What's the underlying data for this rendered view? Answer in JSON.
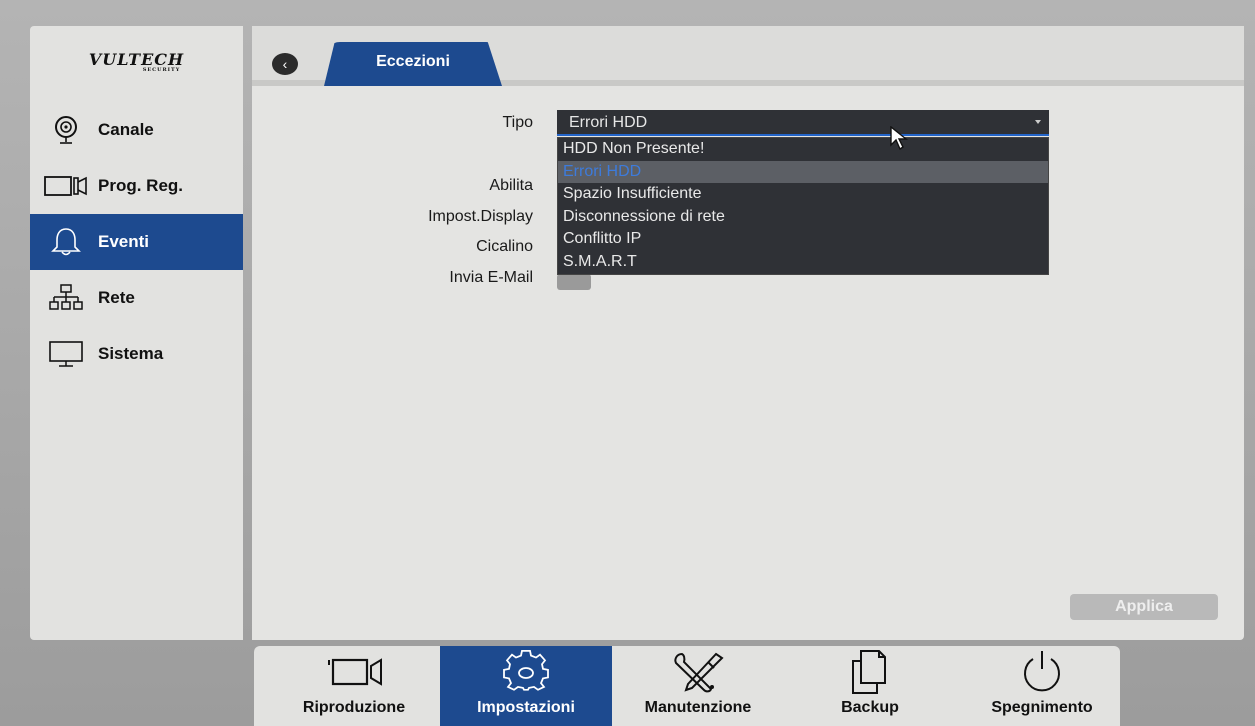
{
  "brand": {
    "name": "VULTECH",
    "tagline": "SECURITY"
  },
  "sidebar": {
    "items": [
      {
        "label": "Canale",
        "icon": "camera-icon",
        "active": false
      },
      {
        "label": "Prog. Reg.",
        "icon": "video-record-icon",
        "active": false
      },
      {
        "label": "Eventi",
        "icon": "bell-icon",
        "active": true
      },
      {
        "label": "Rete",
        "icon": "network-icon",
        "active": false
      },
      {
        "label": "Sistema",
        "icon": "monitor-icon",
        "active": false
      }
    ]
  },
  "header": {
    "tab_label": "Eccezioni",
    "back_icon": "back-arrow-icon"
  },
  "form": {
    "tipo_label": "Tipo",
    "tipo_value": "Errori HDD",
    "abilita_label": "Abilita",
    "display_label": "Impost.Display",
    "cicalino_label": "Cicalino",
    "email_label": "Invia E-Mail",
    "options": [
      "HDD Non Presente!",
      "Errori HDD",
      "Spazio Insufficiente",
      "Disconnessione di rete",
      "Conflitto IP",
      "S.M.A.R.T"
    ],
    "selected_option_index": 1
  },
  "apply_label": "Applica",
  "bottom": {
    "items": [
      {
        "label": "Riproduzione",
        "icon": "video-camera-icon",
        "active": false
      },
      {
        "label": "Impostazioni",
        "icon": "gear-icon",
        "active": true
      },
      {
        "label": "Manutenzione",
        "icon": "tools-icon",
        "active": false
      },
      {
        "label": "Backup",
        "icon": "copy-icon",
        "active": false
      },
      {
        "label": "Spegnimento",
        "icon": "power-icon",
        "active": false
      }
    ]
  },
  "colors": {
    "accent": "#1d4a8f",
    "dropdown_bg": "#2f3136",
    "selected_text": "#3d7bdb"
  }
}
